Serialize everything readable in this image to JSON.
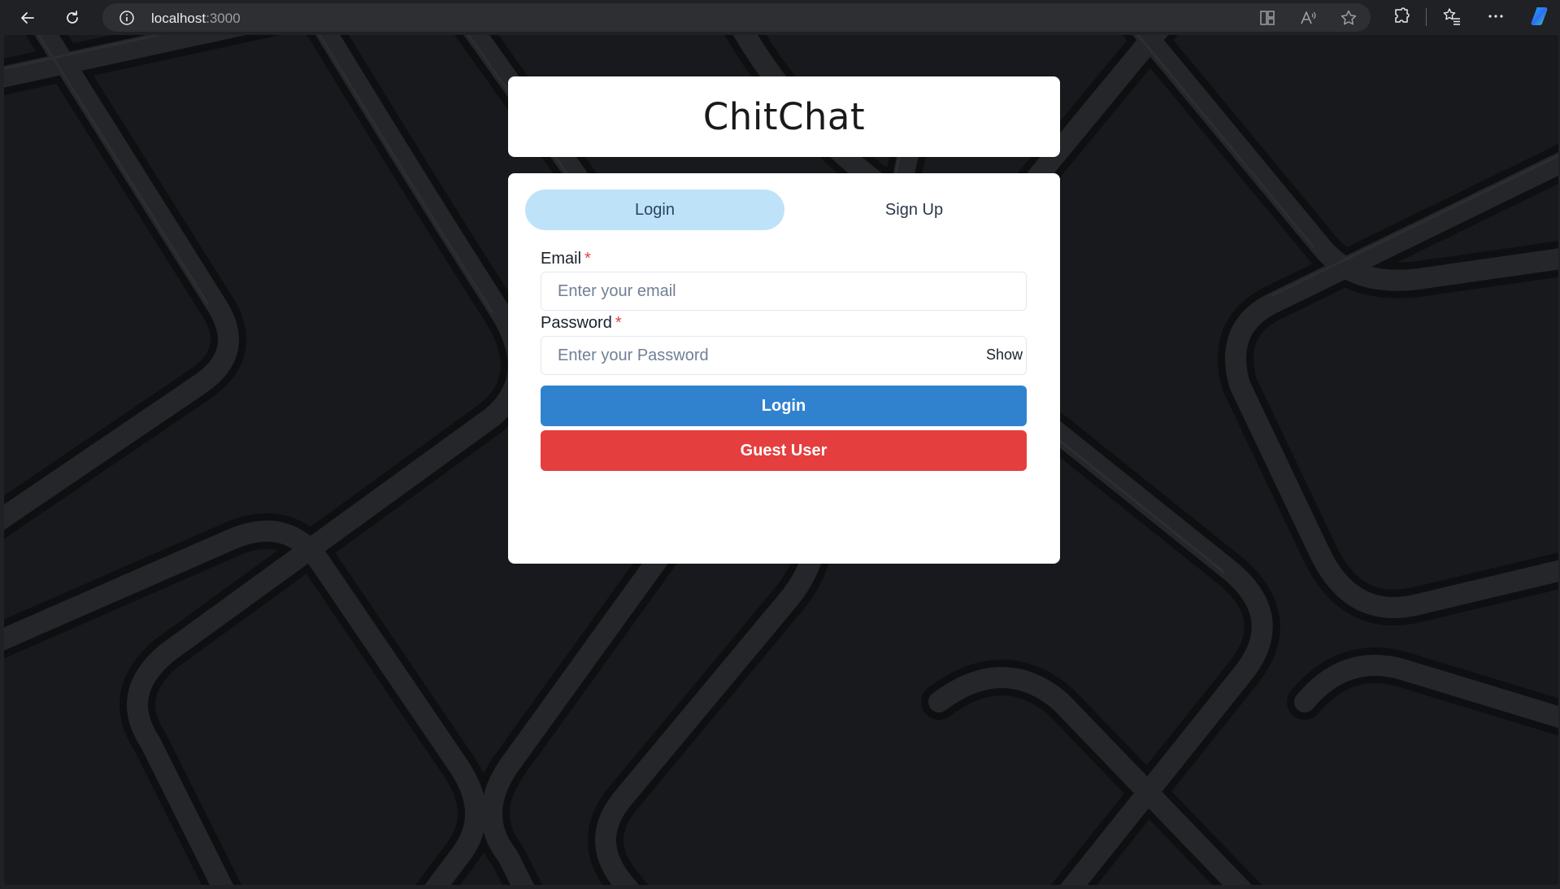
{
  "browser": {
    "url_host": "localhost",
    "url_port": ":3000",
    "icons": [
      "back-arrow-icon",
      "refresh-icon",
      "info-icon",
      "split-screen-icon",
      "read-aloud-icon",
      "favorite-star-icon",
      "extensions-icon",
      "favorites-icon",
      "more-icon",
      "copilot-icon"
    ]
  },
  "app": {
    "title": "ChitChat"
  },
  "tabs": {
    "login": "Login",
    "signup": "Sign Up",
    "active": "login"
  },
  "form": {
    "email_label": "Email",
    "email_placeholder": "Enter your email",
    "password_label": "Password",
    "password_placeholder": "Enter your Password",
    "required_mark": "*",
    "show_label": "Show",
    "login_button": "Login",
    "guest_button": "Guest User"
  },
  "colors": {
    "active_tab": "#bee3f8",
    "primary_button": "#3182ce",
    "danger_button": "#e53e3e",
    "required": "#e53e3e"
  }
}
